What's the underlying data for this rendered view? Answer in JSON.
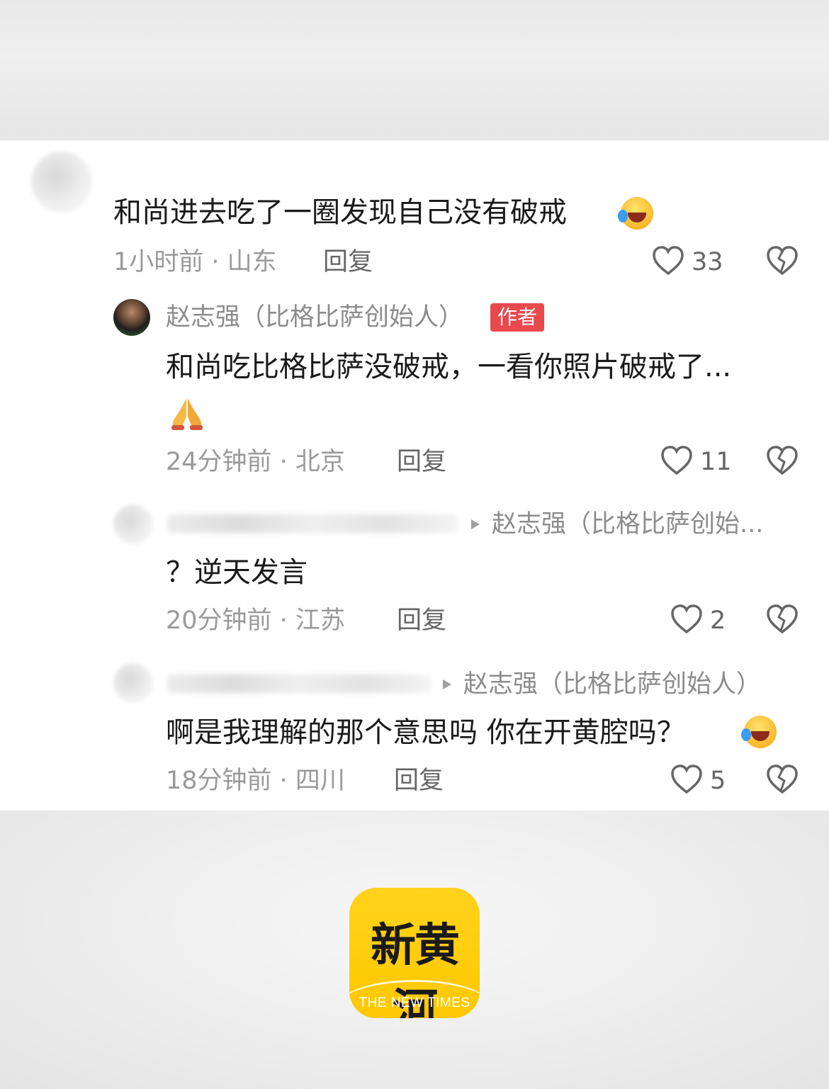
{
  "comments": [
    {
      "text": "和尚进去吃了一圈发现自己没有破戒",
      "meta": "1小时前 · 山东",
      "reply_label": "回复",
      "likes": "33"
    },
    {
      "username": "赵志强（比格比萨创始人）",
      "author_tag": "作者",
      "text": "和尚吃比格比萨没破戒，一看你照片破戒了...",
      "meta": "24分钟前 · 北京",
      "reply_label": "回复",
      "likes": "11"
    },
    {
      "reply_to": "赵志强（比格比萨创始...",
      "text": "？逆天发言",
      "meta": "20分钟前 · 江苏",
      "reply_label": "回复",
      "likes": "2"
    },
    {
      "reply_to": "赵志强（比格比萨创始人）",
      "text": "啊是我理解的那个意思吗 你在开黄腔吗？",
      "meta": "18分钟前 · 四川",
      "reply_label": "回复",
      "likes": "5"
    }
  ],
  "logo": {
    "title": "新黄河",
    "subtitle": "THE NEW TIMES"
  },
  "icons": {
    "like": "heart-icon",
    "dislike": "broken-heart-icon",
    "emoji_laugh": "laughing-crying-emoji",
    "emoji_pray": "praying-hands-emoji",
    "reply_arrow": "triangle-right-icon"
  }
}
